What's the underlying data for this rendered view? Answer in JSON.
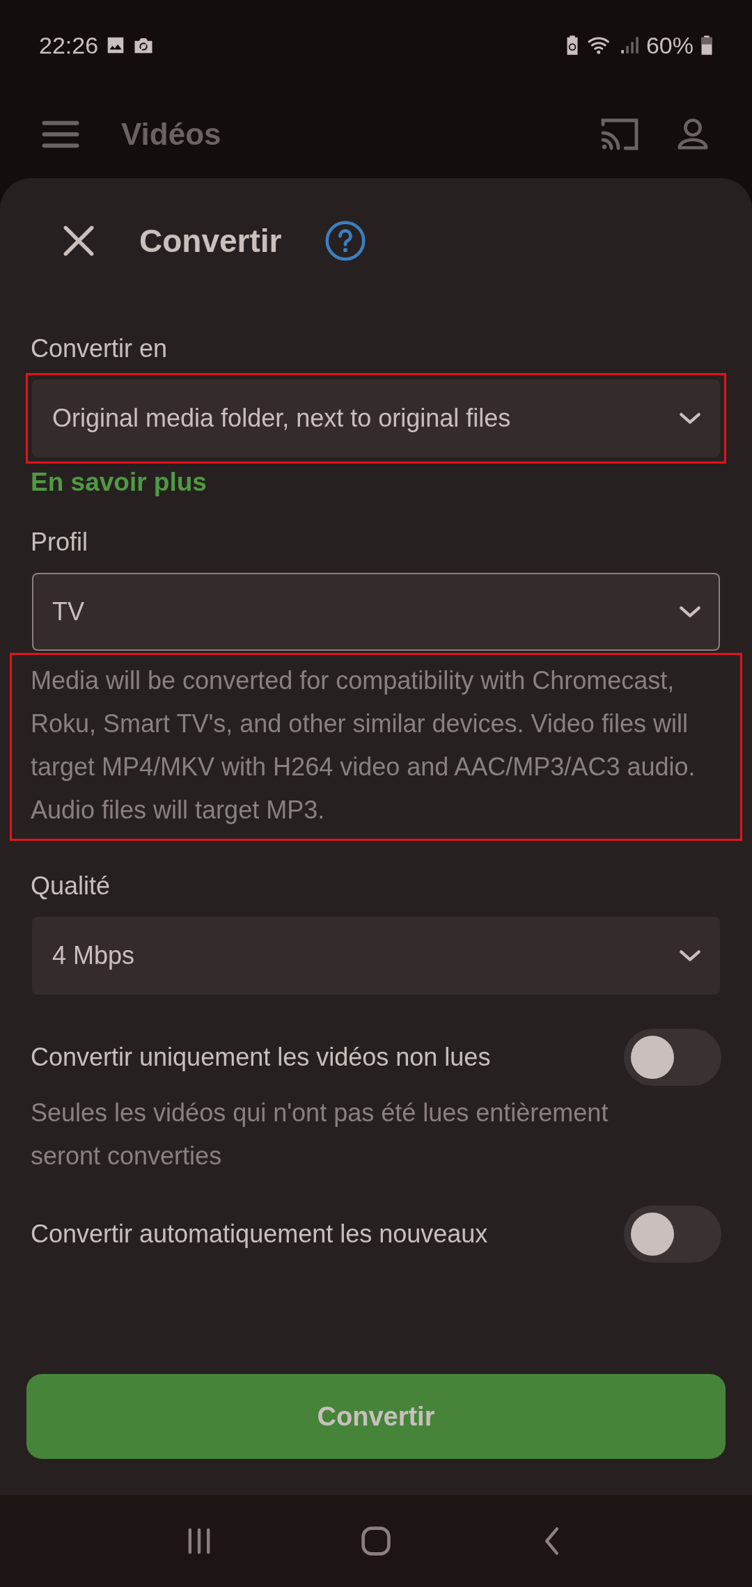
{
  "status_bar": {
    "time": "22:26",
    "battery": "60%"
  },
  "app_bar": {
    "title": "Vidéos"
  },
  "sheet": {
    "title": "Convertir"
  },
  "destination": {
    "label": "Convertir en",
    "value": "Original media folder, next to original files",
    "focused": false,
    "highlighted": true
  },
  "learn_more_link": "En savoir plus",
  "profile": {
    "label": "Profil",
    "value": "TV",
    "focused": true,
    "highlighted": false
  },
  "profile_description": {
    "text": "Media will be converted for compatibility with Chromecast, Roku, Smart TV's, and other similar devices. Video files will target MP4/MKV with H264 video and AAC/MP3/AC3 audio. Audio files will target MP3.",
    "highlighted": true
  },
  "quality": {
    "label": "Qualité",
    "value": "4 Mbps",
    "focused": false,
    "highlighted": false
  },
  "toggles": [
    {
      "label": "Convertir uniquement les vidéos non lues",
      "description": "Seules les vidéos qui n'ont pas été lues entièrement seront converties",
      "on": false
    },
    {
      "label": "Convertir automatiquement les nouveaux",
      "on": false
    }
  ],
  "convert_button": "Convertir"
}
